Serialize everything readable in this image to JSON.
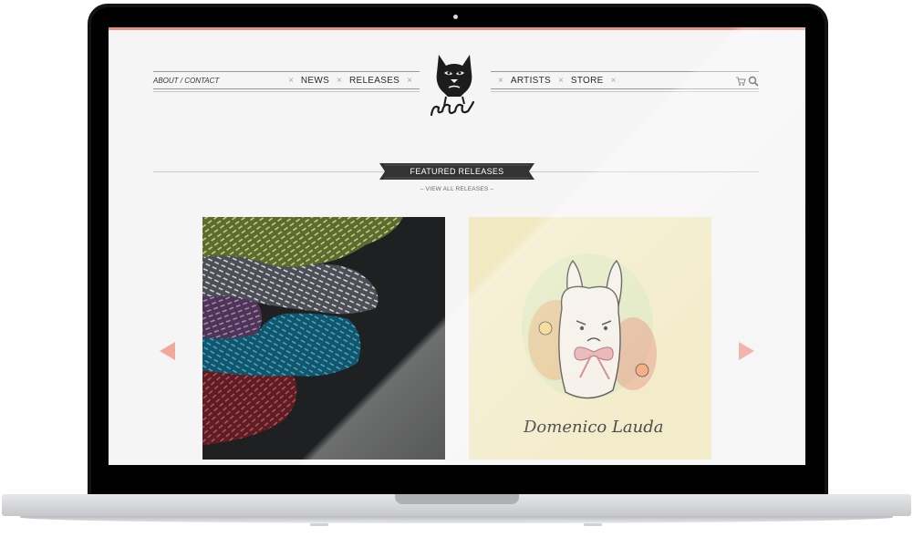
{
  "nav": {
    "about": "About / Contact",
    "sep": "×",
    "news": "News",
    "releases": "Releases",
    "artists": "Artists",
    "store": "Store"
  },
  "featured": {
    "title": "Featured Releases",
    "view_all": "– View all releases –"
  },
  "albums": [
    {
      "cover": "abstract-colored-leaves-cover"
    },
    {
      "cover": "illustrated-rabbit-cover",
      "artist_script": "Domenico Lauda"
    }
  ],
  "icons": {
    "cart": "cart-icon",
    "search": "search-icon",
    "prev": "arrow-left-icon",
    "next": "arrow-right-icon"
  },
  "colors": {
    "accent": "#ea8f84",
    "ribbon": "#333333",
    "arrow": "#f0a89c"
  }
}
